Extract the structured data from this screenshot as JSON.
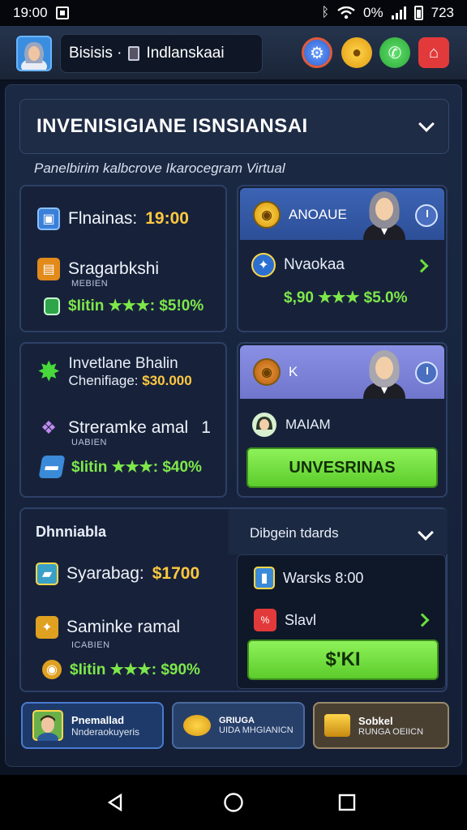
{
  "status": {
    "time": "19:00",
    "right_text": "0%",
    "battery_text": "723"
  },
  "topbar": {
    "title_left": "Bisisis ·",
    "title_right": "Indlanskaai",
    "icons": [
      "gear-icon",
      "coin-icon",
      "phone-icon",
      "alert-icon"
    ],
    "colors": {
      "gear": "#e05a3a",
      "coin": "#f2b21a",
      "phone": "#3cc24a",
      "alert": "#e23a3a"
    }
  },
  "header": {
    "title": "INVENISIGIANE ISNSIANSAI"
  },
  "subtitle": "Panelbirim kalbcrove Ikarocegram Virtual",
  "card1": {
    "finance_label": "Flnainas:",
    "finance_value": "19:00",
    "item_title": "Sragarbkshi",
    "item_sub": "MEBIEN",
    "stat": "$Iitin ★★★: $5!0%"
  },
  "card2": {
    "head_label": "ANOAUE",
    "item_label": "Nvaokaa",
    "stat": "$,90 ★★★ $5.0%"
  },
  "card3": {
    "line1": "Invetlane Bhalin",
    "line2_label": "Chenifiage:",
    "line2_value": "$30.000",
    "item_title": "Streramke amal",
    "item_num": "1",
    "item_sub": "UABIEN",
    "stat": "$Iitin ★★★: $40%"
  },
  "card4": {
    "head_label": "K",
    "person_label": "MAIAM",
    "button_label": "UNVESRINAS"
  },
  "card5": {
    "left_title": "Dhnniabla",
    "row1_label": "Syarabag:",
    "row1_value": "$1700",
    "row2_title": "Saminke ramal",
    "row2_sub": "ICABIEN",
    "stat": "$Iitin ★★★: $90%",
    "right_title": "Dibgein tdards",
    "right_row1": "Warsks 8:00",
    "right_row2": "Slavl",
    "right_button": "$'KI"
  },
  "bottom_tabs": [
    {
      "l1": "Pnemallad",
      "l2": "Nnderaokuyeris"
    },
    {
      "l1": "GRIUGA",
      "l2": "UIDA MHGIANICN"
    },
    {
      "l1": "Sobkel",
      "l2": "RUNGA OEIICN"
    }
  ]
}
